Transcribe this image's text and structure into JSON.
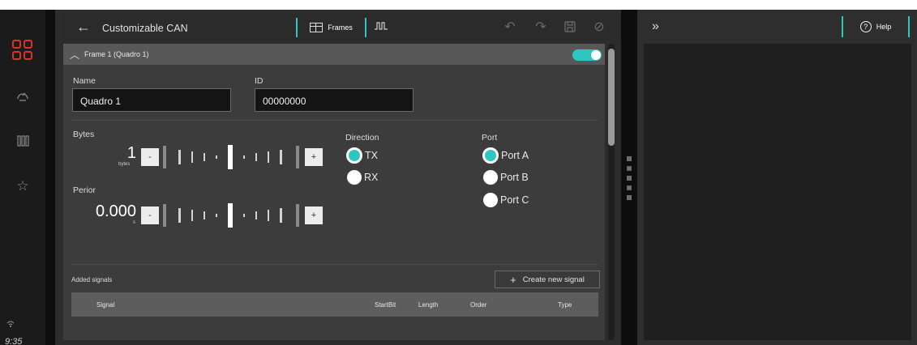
{
  "rail": {
    "time": "9:35"
  },
  "header": {
    "title": "Customizable CAN",
    "tab_frames_label": "Frames"
  },
  "frame": {
    "title": "Frame 1 (Quadro 1)",
    "enabled": true,
    "name_label": "Name",
    "name_value": "Quadro 1",
    "id_label": "ID",
    "id_value": "00000000",
    "bytes_label": "Bytes",
    "bytes_value": "1",
    "bytes_unit": "bytes",
    "period_label": "Perior",
    "period_value": "0.000",
    "period_unit": "s",
    "minus_label": "-",
    "plus_label": "+",
    "direction_label": "Direction",
    "direction_options": [
      "TX",
      "RX"
    ],
    "direction_selected": "TX",
    "port_label": "Port",
    "port_options": [
      "Port A",
      "Port B",
      "Port C"
    ],
    "port_selected": "Port A"
  },
  "signals": {
    "section_label": "Added signals",
    "create_button": "Create new signal",
    "columns": [
      "Signal",
      "StartBit",
      "Length",
      "Order",
      "Type"
    ]
  },
  "help": {
    "label": "Help"
  },
  "colors": {
    "accent": "#2fc6c2",
    "brand": "#d9342b"
  }
}
